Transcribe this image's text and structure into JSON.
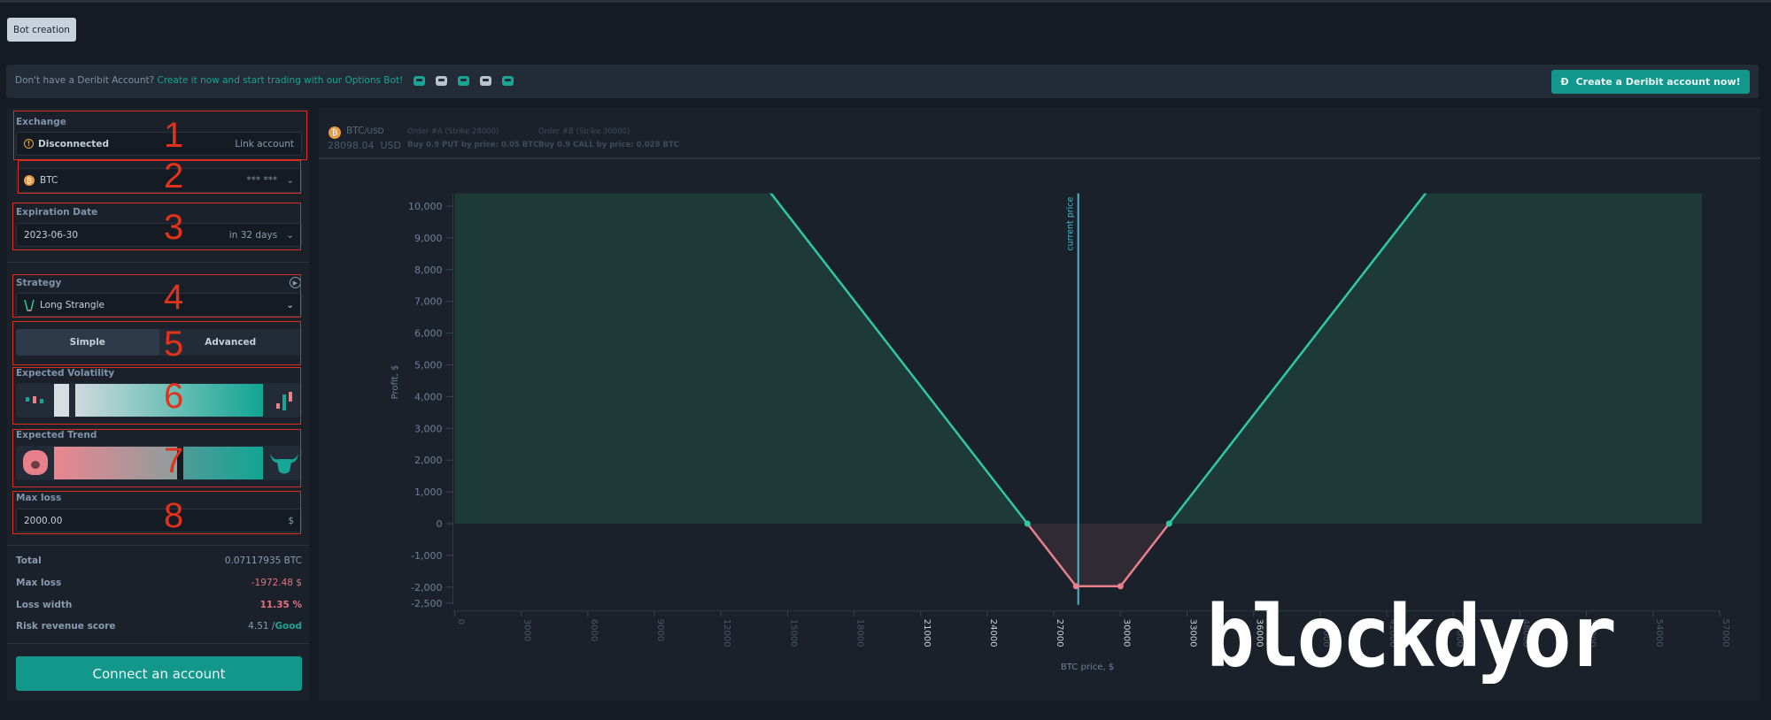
{
  "tab": {
    "label": "Bot creation"
  },
  "banner": {
    "text": "Don't have a Deribit Account?",
    "link": "Create it now and start trading with our Options Bot!",
    "bot_icons": [
      "#17a595",
      "#b9c2cf",
      "#17a595",
      "#b9c2cf",
      "#17a595"
    ],
    "button": "Create a Deribit account now!"
  },
  "form": {
    "exchange_label": "Exchange",
    "status": "Disconnected",
    "link_account": "Link account",
    "asset": "BTC",
    "balance": "*** ***",
    "expiration_label": "Expiration Date",
    "expiration": "2023-06-30",
    "expiration_hint": "in 32 days",
    "strategy_label": "Strategy",
    "strategy": "Long Strangle",
    "mode_simple": "Simple",
    "mode_advanced": "Advanced",
    "mode_selected": "Simple",
    "volatility_label": "Expected Volatility",
    "volatility_level": 0.9,
    "trend_label": "Expected Trend",
    "trend_level": 0.55,
    "maxloss_label": "Max loss",
    "maxloss": "2000.00",
    "maxloss_unit": "$"
  },
  "summary": {
    "total_label": "Total",
    "total": "0.07117935 BTC",
    "maxloss_label": "Max loss",
    "maxloss": "-1972.48 $",
    "losswidth_label": "Loss width",
    "losswidth": "11.35 %",
    "risk_label": "Risk revenue score",
    "risk": "4.51 /",
    "risk_grade": "Good"
  },
  "connect_button": "Connect an account",
  "annotations": [
    "1",
    "2",
    "3",
    "4",
    "5",
    "6",
    "7",
    "8"
  ],
  "chart_header": {
    "pair": "BTC",
    "pair_quote": "/USD",
    "price": "28098.04  USD",
    "orders": [
      {
        "title": "Order #A (Strike 28000)",
        "desc": "Buy 0.9 PUT by price: 0.05 BTC"
      },
      {
        "title": "Order #B (Strike 30000)",
        "desc": "Buy 0.9 CALL by price: 0.028 BTC"
      }
    ]
  },
  "watermark": "blockdyor",
  "colors": {
    "profit": "#2fc9a0",
    "loss": "#e8808b",
    "current": "#4ab8c8",
    "accent": "#13968b"
  },
  "chart_data": {
    "type": "line",
    "xlabel": "BTC price, $",
    "ylabel": "Profit, $",
    "xlim": [
      0,
      57000
    ],
    "ylim": [
      -2500,
      10400
    ],
    "xticks": [
      0,
      3000,
      6000,
      9000,
      12000,
      15000,
      18000,
      21000,
      24000,
      27000,
      30000,
      33000,
      36000,
      39000,
      42000,
      45000,
      48000,
      51000,
      54000,
      57000
    ],
    "yticks": [
      {
        "v": 10000,
        "t": "10,000"
      },
      {
        "v": 9000,
        "t": "9,000"
      },
      {
        "v": 8000,
        "t": "8,000"
      },
      {
        "v": 7000,
        "t": "7,000"
      },
      {
        "v": 6000,
        "t": "6,000"
      },
      {
        "v": 5000,
        "t": "5,000"
      },
      {
        "v": 4000,
        "t": "4,000"
      },
      {
        "v": 3000,
        "t": "3,000"
      },
      {
        "v": 2000,
        "t": "2,000"
      },
      {
        "v": 1000,
        "t": "1,000"
      },
      {
        "v": 0,
        "t": "0"
      },
      {
        "v": -1000,
        "t": "-1,000"
      },
      {
        "v": -2000,
        "t": "-2,000"
      },
      {
        "v": -2500,
        "t": "-2,500"
      }
    ],
    "series": [
      {
        "x": [
          0,
          25808,
          28000,
          30000,
          32192,
          56200
        ],
        "y": [
          23227.52,
          0,
          -1972.48,
          -1972.48,
          0,
          21607.52
        ]
      }
    ],
    "markers": [
      {
        "x": 25808,
        "y": 0
      },
      {
        "x": 28000,
        "y": -1972.48
      },
      {
        "x": 30000,
        "y": -1972.48
      },
      {
        "x": 32192,
        "y": 0
      }
    ],
    "current_price": {
      "x": 28098.04,
      "label": "current price"
    }
  }
}
